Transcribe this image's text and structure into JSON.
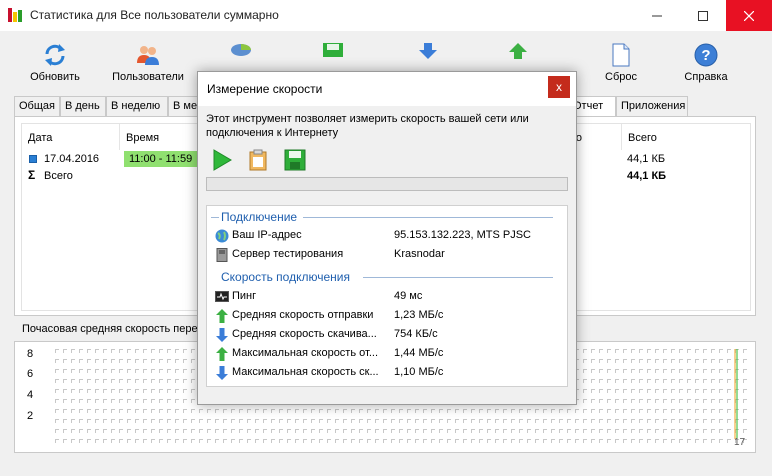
{
  "window": {
    "title": "Статистика для Все пользователи суммарно"
  },
  "toolbar": {
    "refresh": "Обновить",
    "users": "Пользователи",
    "reset": "Сброс",
    "help": "Справка"
  },
  "tabs": {
    "general": "Общая",
    "per_day": "В день",
    "per_week": "В неделю",
    "per_month": "В мес",
    "report": "Отчет",
    "applications": "Приложения"
  },
  "table": {
    "headers": {
      "date": "Дата",
      "time": "Время",
      "partial": "чено",
      "total": "Всего"
    },
    "row": {
      "date": "17.04.2016",
      "time": "11:00 - 11:59",
      "total": "44,1 КБ"
    },
    "sum": {
      "label": "Всего",
      "total": "44,1 КБ"
    }
  },
  "hourly_label": "Почасовая средняя скорость перед",
  "chart": {
    "y_ticks": [
      "8",
      "6",
      "4",
      "2"
    ],
    "x_tick": "17"
  },
  "dialog": {
    "title": "Измерение скорости",
    "close": "x",
    "description": "Этот инструмент позволяет измерить скорость вашей сети или подключения к Интернету",
    "progress": 0,
    "connection_title": "Подключение",
    "ip_label": "Ваш IP-адрес",
    "ip_value": "95.153.132.223, MTS PJSC",
    "server_label": "Сервер тестирования",
    "server_value": "Krasnodar",
    "speed_title": "Скорость подключения",
    "ping_label": "Пинг",
    "ping_value": "49 мс",
    "avg_up_label": "Средняя скорость отправки",
    "avg_up_value": "1,23 МБ/с",
    "avg_down_label": "Средняя скорость скачива...",
    "avg_down_value": "754 КБ/с",
    "max_up_label": "Максимальная скорость от...",
    "max_up_value": "1,44 МБ/с",
    "max_down_label": "Максимальная скорость ск...",
    "max_down_value": "1,10 МБ/с"
  },
  "colors": {
    "accent": "#1f5fae",
    "green": "#2eb82e",
    "close": "#e81123",
    "highlight": "#90e070",
    "bar": "#f0a020"
  }
}
